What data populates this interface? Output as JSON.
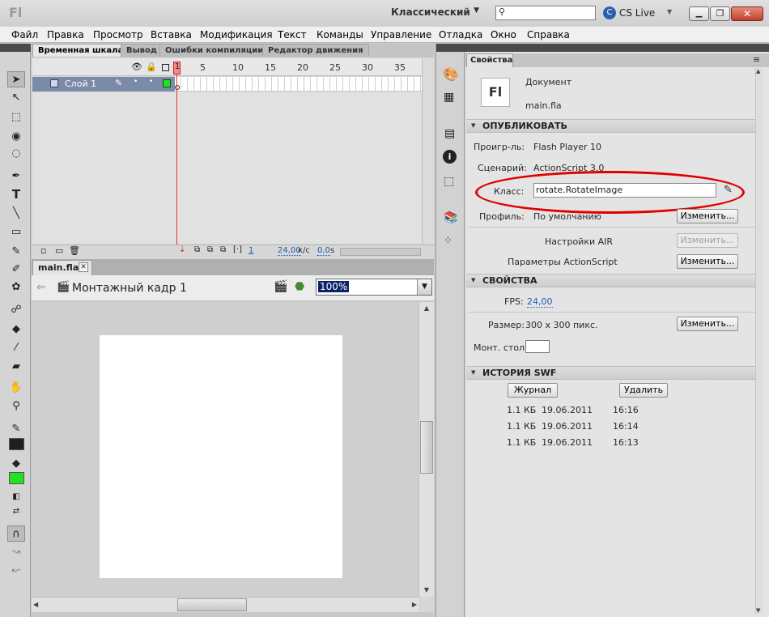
{
  "app": {
    "logo": "Fl",
    "workspace": "Классический",
    "search_placeholder": "",
    "cslive": "CS Live"
  },
  "menu": [
    "Файл",
    "Правка",
    "Просмотр",
    "Вставка",
    "Модификация",
    "Текст",
    "Команды",
    "Управление",
    "Отладка",
    "Окно",
    "Справка"
  ],
  "timeline": {
    "tabs": [
      "Временная шкала",
      "Вывод",
      "Ошибки компиляции",
      "Редактор движения"
    ],
    "layer_name": "Слой 1",
    "frame_ticks": [
      "1",
      "5",
      "10",
      "15",
      "20",
      "25",
      "30",
      "35"
    ],
    "current_frame": "1",
    "fps_value": "24,00",
    "fps_unit": "к/с",
    "time_value": "0,0",
    "time_unit": "s"
  },
  "document": {
    "tab": "main.fla",
    "scene": "Монтажный кадр 1",
    "zoom": "100%"
  },
  "properties": {
    "tab": "Свойства",
    "doc_type": "Документ",
    "doc_name": "main.fla",
    "publish": {
      "title": "ОПУБЛИКОВАТЬ",
      "player_label": "Проигр-ль:",
      "player_value": "Flash Player 10",
      "script_label": "Сценарий:",
      "script_value": "ActionScript 3.0",
      "class_label": "Класс:",
      "class_value": "rotate.RotateImage",
      "profile_label": "Профиль:",
      "profile_value": "По умолчанию",
      "change": "Изменить...",
      "air_label": "Настройки AIR",
      "as_label": "Параметры ActionScript"
    },
    "props": {
      "title": "СВОЙСТВА",
      "fps_label": "FPS:",
      "fps_value": "24,00",
      "size_label": "Размер:",
      "size_value": "300 x 300 пикс.",
      "stage_label": "Монт. стол:",
      "stage_color": "#ffffff"
    },
    "swf": {
      "title": "ИСТОРИЯ SWF",
      "log": "Журнал",
      "delete": "Удалить",
      "rows": [
        {
          "size": "1.1 КБ",
          "date": "19.06.2011",
          "time": "16:16"
        },
        {
          "size": "1.1 КБ",
          "date": "19.06.2011",
          "time": "16:14"
        },
        {
          "size": "1.1 КБ",
          "date": "19.06.2011",
          "time": "16:13"
        }
      ]
    }
  },
  "colors": {
    "stroke": "#1f1f1f",
    "fill": "#22e022",
    "highlight": "#e00000",
    "layer_selected": "#7a8aa8"
  }
}
